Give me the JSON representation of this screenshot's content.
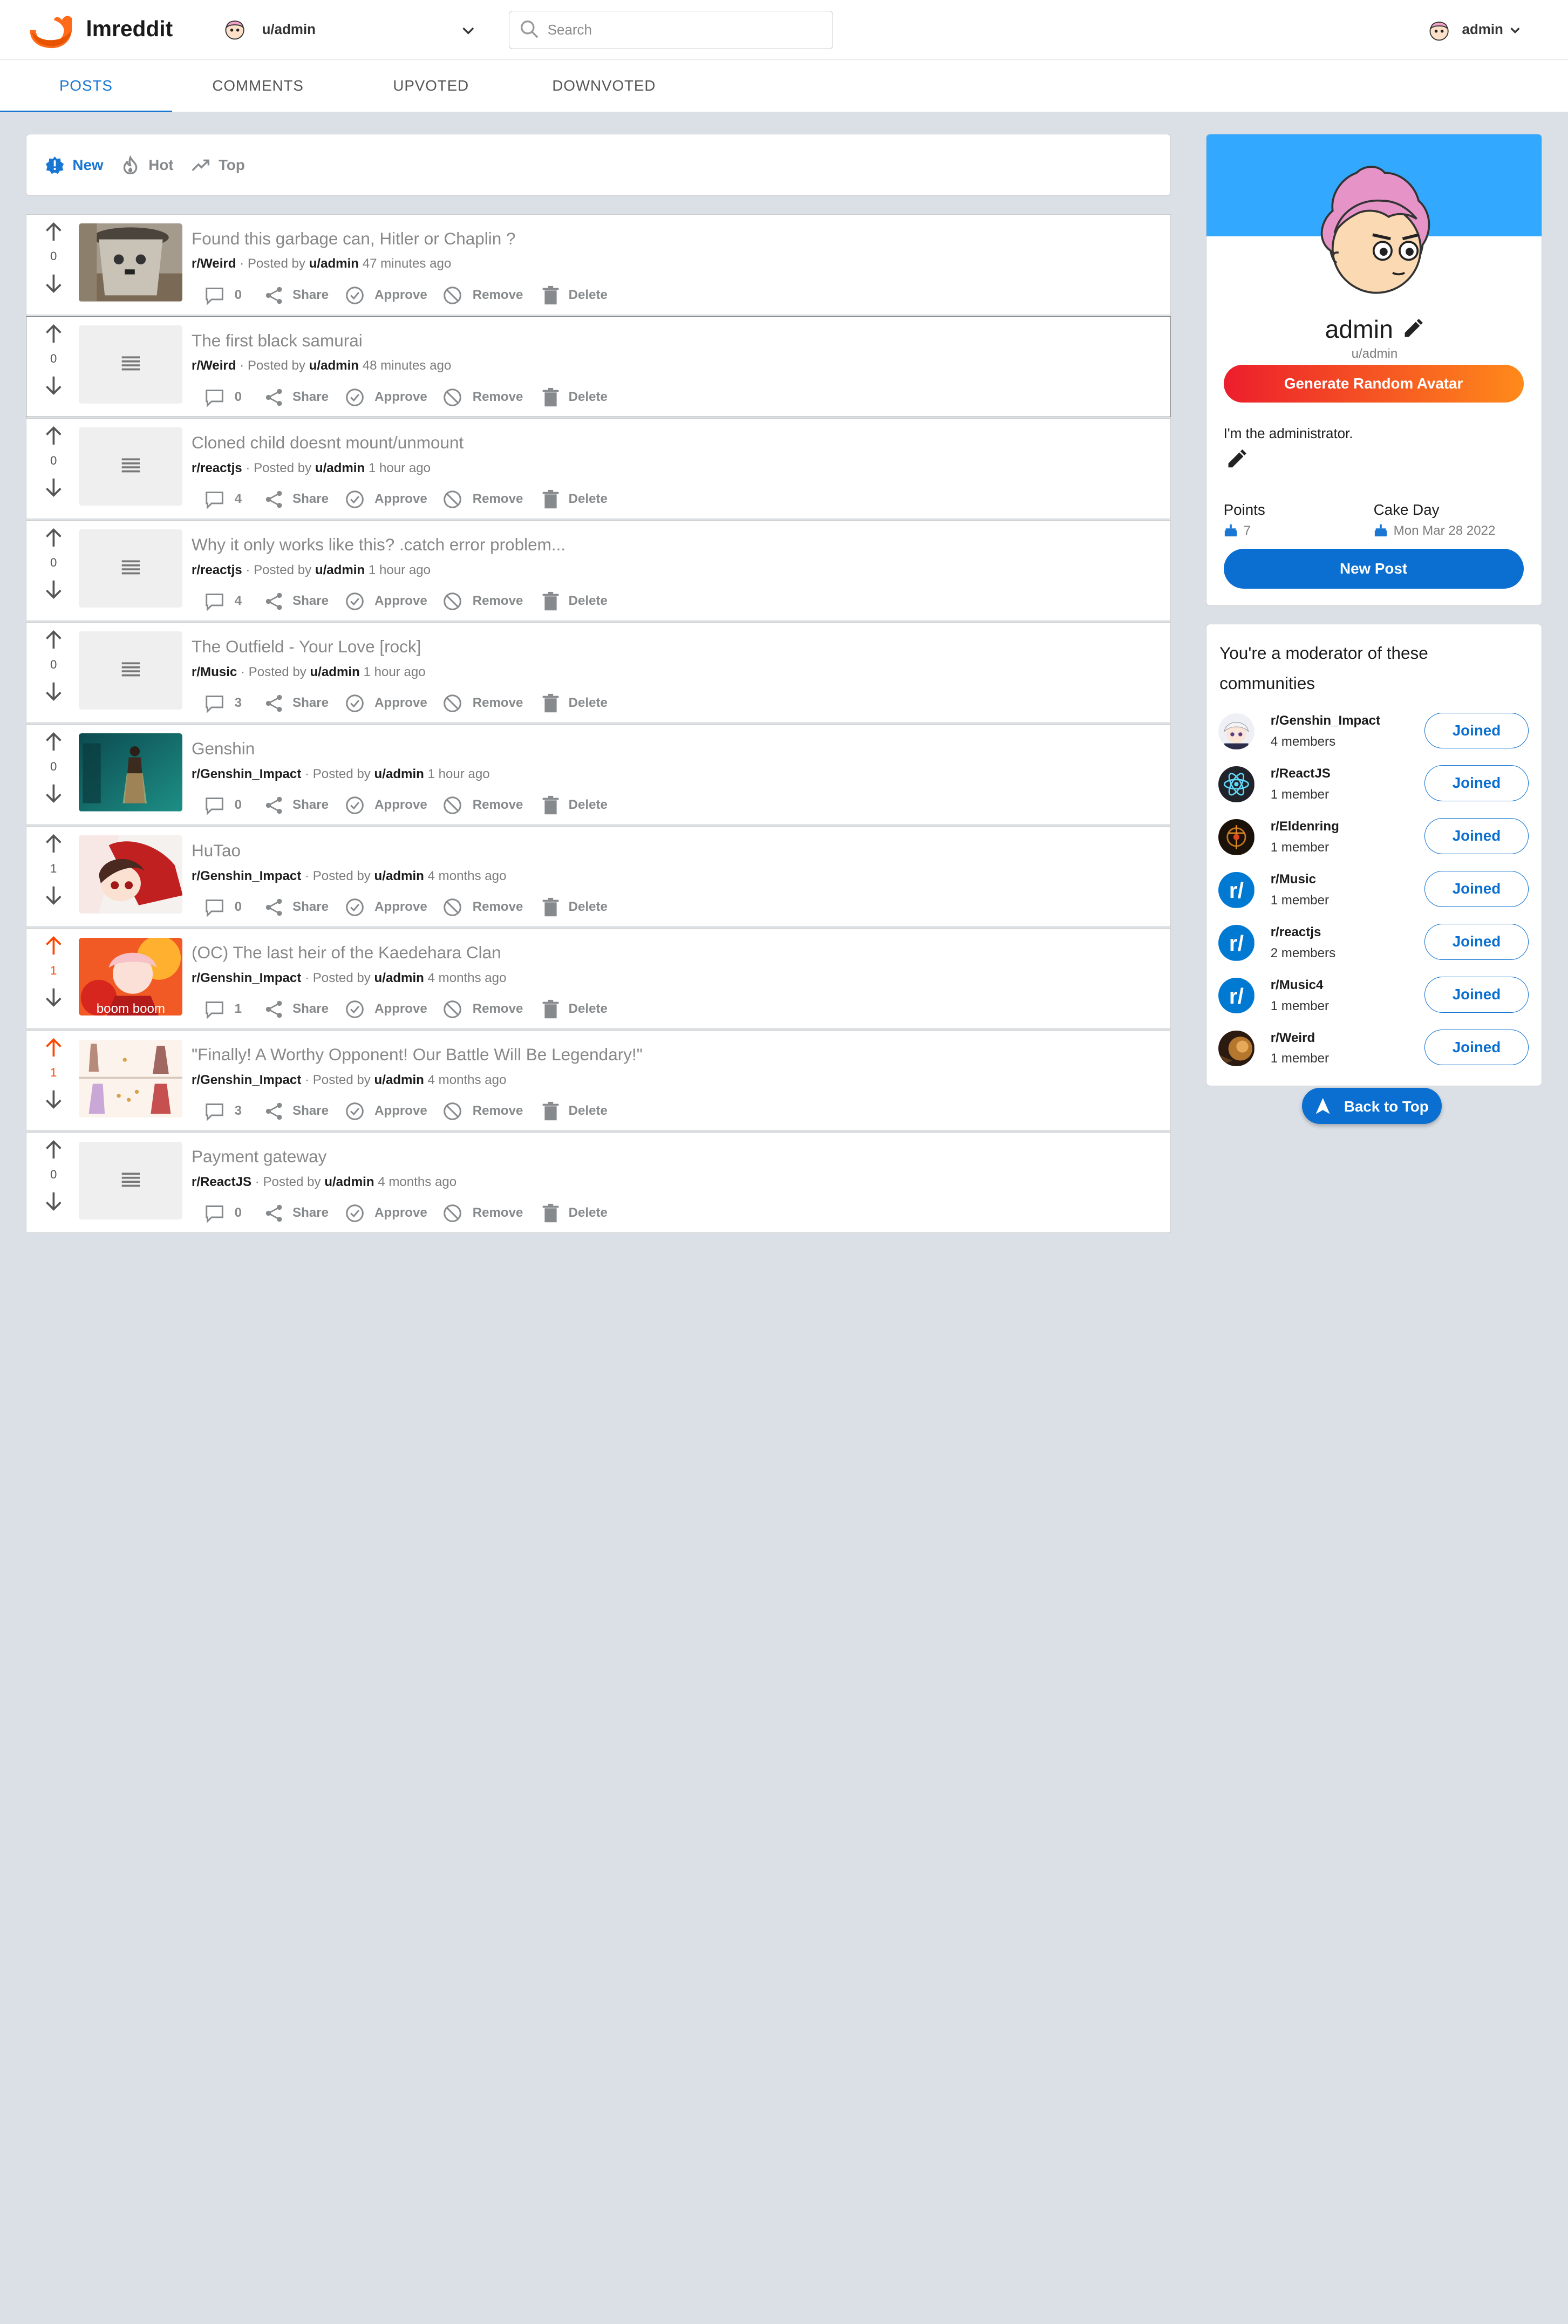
{
  "app": {
    "title": "lmreddit"
  },
  "header": {
    "subreddit_selector": "u/admin",
    "search_placeholder": "Search",
    "user_name": "admin"
  },
  "tabs": [
    "POSTS",
    "COMMENTS",
    "UPVOTED",
    "DOWNVOTED"
  ],
  "sort": [
    "New",
    "Hot",
    "Top"
  ],
  "actions": {
    "share": "Share",
    "approve": "Approve",
    "remove": "Remove",
    "delete": "Delete"
  },
  "posts": [
    {
      "title": "Found this garbage can, Hitler or Chaplin ?",
      "sub": "r/Weird",
      "posted_by": "Posted by",
      "user": "u/admin",
      "time": "47 minutes ago",
      "score": "0",
      "comments": "0",
      "thumb": "photo"
    },
    {
      "title": "The first black samurai",
      "sub": "r/Weird",
      "posted_by": "Posted by",
      "user": "u/admin",
      "time": "48 minutes ago",
      "score": "0",
      "comments": "0",
      "thumb": "text"
    },
    {
      "title": "Cloned child doesnt mount/unmount",
      "sub": "r/reactjs",
      "posted_by": "Posted by",
      "user": "u/admin",
      "time": "1 hour ago",
      "score": "0",
      "comments": "4",
      "thumb": "text"
    },
    {
      "title": "Why it only works like this? .catch error problem...",
      "sub": "r/reactjs",
      "posted_by": "Posted by",
      "user": "u/admin",
      "time": "1 hour ago",
      "score": "0",
      "comments": "4",
      "thumb": "text"
    },
    {
      "title": "The Outfield - Your Love [rock]",
      "sub": "r/Music",
      "posted_by": "Posted by",
      "user": "u/admin",
      "time": "1 hour ago",
      "score": "0",
      "comments": "3",
      "thumb": "text"
    },
    {
      "title": "Genshin",
      "sub": "r/Genshin_Impact",
      "posted_by": "Posted by",
      "user": "u/admin",
      "time": "1 hour ago",
      "score": "0",
      "comments": "0",
      "thumb": "game"
    },
    {
      "title": "HuTao",
      "sub": "r/Genshin_Impact",
      "posted_by": "Posted by",
      "user": "u/admin",
      "time": "4 months ago",
      "score": "1",
      "comments": "0",
      "thumb": "anime"
    },
    {
      "title": "(OC) The last heir of the Kaedehara Clan",
      "sub": "r/Genshin_Impact",
      "posted_by": "Posted by",
      "user": "u/admin",
      "time": "4 months ago",
      "score": "1",
      "comments": "1",
      "thumb": "fire",
      "upvoted": true,
      "thumb_caption": "boom boom"
    },
    {
      "title": "\"Finally! A Worthy Opponent! Our Battle Will Be Legendary!\"",
      "sub": "r/Genshin_Impact",
      "posted_by": "Posted by",
      "user": "u/admin",
      "time": "4 months ago",
      "score": "1",
      "comments": "3",
      "thumb": "comic",
      "upvoted": true
    },
    {
      "title": "Payment gateway",
      "sub": "r/ReactJS",
      "posted_by": "Posted by",
      "user": "u/admin",
      "time": "4 months ago",
      "score": "0",
      "comments": "0",
      "thumb": "text"
    }
  ],
  "profile": {
    "name": "admin",
    "username": "u/admin",
    "generate_label": "Generate Random Avatar",
    "bio": "I'm the administrator.",
    "points_label": "Points",
    "points": "7",
    "cakeday_label": "Cake Day",
    "cakeday": "Mon Mar 28 2022",
    "new_post_label": "New Post"
  },
  "moderator": {
    "title": "You're a moderator of these communities",
    "joined_label": "Joined",
    "communities": [
      {
        "name": "r/Genshin_Impact",
        "members": "4 members",
        "icon": "paimon"
      },
      {
        "name": "r/ReactJS",
        "members": "1 member",
        "icon": "react"
      },
      {
        "name": "r/Eldenring",
        "members": "1 member",
        "icon": "elden"
      },
      {
        "name": "r/Music",
        "members": "1 member",
        "icon": "reddit"
      },
      {
        "name": "r/reactjs",
        "members": "2 members",
        "icon": "reddit"
      },
      {
        "name": "r/Music4",
        "members": "1 member",
        "icon": "reddit"
      },
      {
        "name": "r/Weird",
        "members": "1 member",
        "icon": "weird"
      }
    ]
  },
  "back_to_top": "Back to Top",
  "colors": {
    "accent": "#1976d2",
    "upvote": "#ff4500",
    "banner": "#33a8ff",
    "button_blue": "#0a6fd0"
  }
}
